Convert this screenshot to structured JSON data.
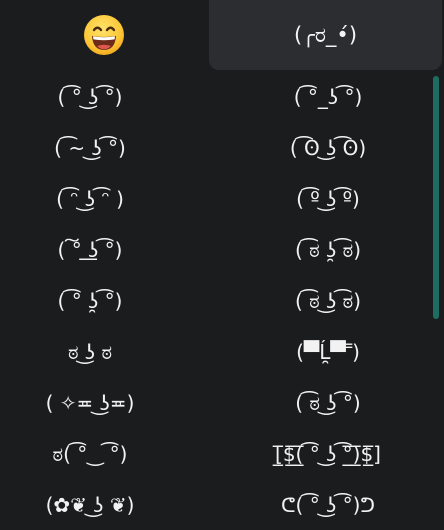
{
  "tabs": {
    "emoji_icon": "grinning-face-icon",
    "kaomoji_label": "(╭ರ_•́)"
  },
  "colors": {
    "background": "#1b1c1e",
    "selected_tab": "#2c2d30",
    "scrollbar": "#1e6d63",
    "text": "#f2f2f2"
  },
  "kaomoji": [
    [
      "( ͡° ͜ʖ ͡°)",
      "( ͡°_ʖ ͡°)"
    ],
    [
      "( ͡~ ͜ʖ ͡°)",
      "( ͡ʘ ͜ʖ ͡ʘ)"
    ],
    [
      "( ͡ᵔ ͜ʖ ͡ᵔ )",
      "( ͡º ͜ʖ ͡º)"
    ],
    [
      "( ͠° ͟ʖ ͡°)",
      "( ͡ಠ ʖ̯ ͡ಠ)"
    ],
    [
      "( ͡° ʖ̯ ͡°)",
      "( ͡ಠ ͜ʖ ͡ಠ)"
    ],
    [
      "ಠ ͜ʖ ಠ",
      "(▀̿Ĺ̯▀̿ ̿)"
    ],
    [
      "( ✧≖ ͜ʖ≖)",
      "( ͡ಠ ͜ʖ ͡°)"
    ],
    [
      "ಠ( ͡°‿ ͡°)",
      "[̲̅$̲̅(̲̅ ͡° ͜ʖ ͡°̲̅)̲̅$̲̅]"
    ],
    [
      "(✿❦ ͜ʖ ❦)",
      "ᕦ( ͡° ͜ʖ ͡°)ᕤ"
    ]
  ]
}
